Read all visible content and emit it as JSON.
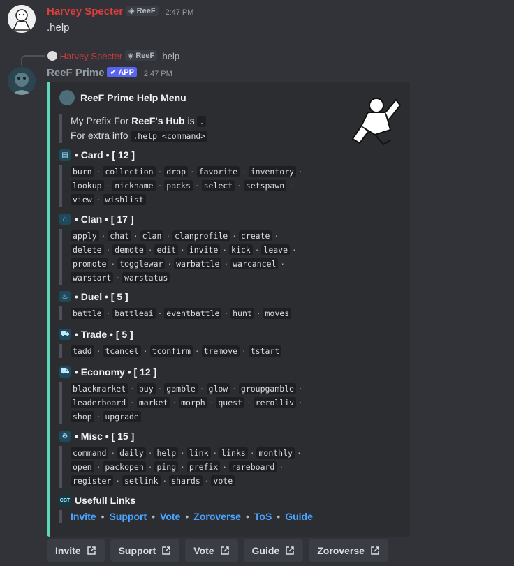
{
  "first_message": {
    "author": "Harvey Specter",
    "author_color": "#e03d3d",
    "tag": "ReeF",
    "time": "2:47 PM",
    "text": ".help"
  },
  "reply_preview": {
    "author": "Harvey Specter",
    "tag": "ReeF",
    "text": ".help"
  },
  "bot_message": {
    "author": "ReeF Prime",
    "badge": "APP",
    "time": "2:47 PM"
  },
  "embed": {
    "accent_color": "#5fd6b9",
    "title": "ReeF Prime Help Menu",
    "prefix_text_a": "My Prefix For ",
    "prefix_bold": "ReeF's Hub",
    "prefix_text_b": " is ",
    "prefix_value": ".",
    "extra_text": "For extra info ",
    "extra_code": ".help <command>",
    "sections": [
      {
        "icon": "card-icon",
        "title": "Card",
        "count": "[ 12 ]",
        "lines": [
          [
            "burn",
            "collection",
            "drop",
            "favorite",
            "inventory"
          ],
          [
            "lookup",
            "nickname",
            "packs",
            "select",
            "setspawn"
          ],
          [
            "view",
            "wishlist"
          ]
        ]
      },
      {
        "icon": "home-icon",
        "title": "Clan",
        "count": "[ 17 ]",
        "lines": [
          [
            "apply",
            "chat",
            "clan",
            "clanprofile",
            "create"
          ],
          [
            "delete",
            "demote",
            "edit",
            "invite",
            "kick",
            "leave"
          ],
          [
            "promote",
            "togglewar",
            "warbattle",
            "warcancel"
          ],
          [
            "warstart",
            "warstatus"
          ]
        ]
      },
      {
        "icon": "fire-icon",
        "title": "Duel",
        "count": "[ 5 ]",
        "lines": [
          [
            "battle",
            "battleai",
            "eventbattle",
            "hunt",
            "moves"
          ]
        ]
      },
      {
        "icon": "cart-icon",
        "title": "Trade",
        "count": "[ 5 ]",
        "lines": [
          [
            "tadd",
            "tcancel",
            "tconfirm",
            "tremove",
            "tstart"
          ]
        ]
      },
      {
        "icon": "cart-icon",
        "title": "Economy",
        "count": "[ 12 ]",
        "lines": [
          [
            "blackmarket",
            "buy",
            "gamble",
            "glow",
            "groupgamble"
          ],
          [
            "leaderboard",
            "market",
            "morph",
            "quest",
            "rerolliv"
          ],
          [
            "shop",
            "upgrade"
          ]
        ]
      },
      {
        "icon": "gear-icon",
        "title": "Misc",
        "count": "[ 15 ]",
        "lines": [
          [
            "command",
            "daily",
            "help",
            "link",
            "links",
            "monthly"
          ],
          [
            "open",
            "packopen",
            "ping",
            "prefix",
            "rareboard"
          ],
          [
            "register",
            "setlink",
            "shards",
            "vote"
          ]
        ]
      }
    ],
    "links_icon_text": "CBT",
    "links_title": "Usefull Links",
    "links": [
      "Invite",
      "Support",
      "Vote",
      "Zoroverse",
      "ToS",
      "Guide"
    ]
  },
  "buttons": [
    "Invite",
    "Support",
    "Vote",
    "Guide",
    "Zoroverse"
  ]
}
